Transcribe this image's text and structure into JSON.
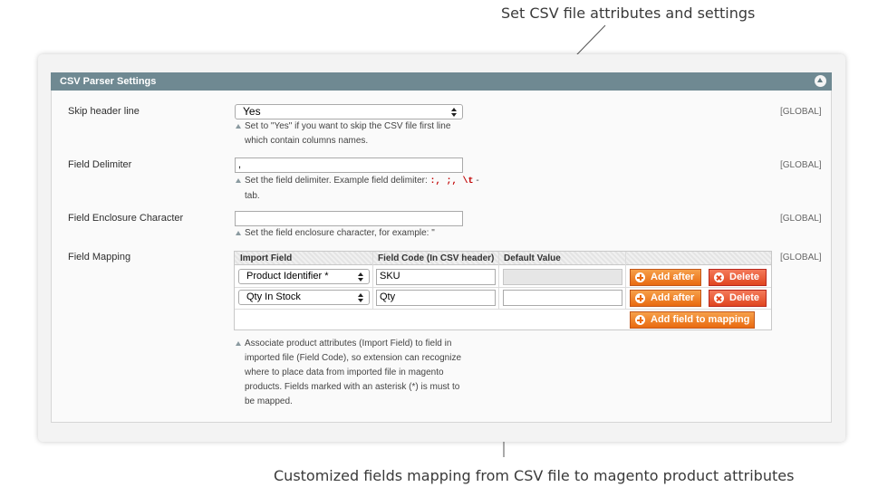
{
  "callouts": {
    "top": "Set CSV file attributes and settings",
    "bottom": "Customized fields mapping from CSV file to magento product attributes"
  },
  "section": {
    "title": "CSV Parser Settings"
  },
  "fields": {
    "skip_header": {
      "label": "Skip header line",
      "value": "Yes",
      "note_line1": "Set to \"Yes\" if you want to skip the CSV file first line",
      "note_line2": "which contain columns names.",
      "scope": "[GLOBAL]"
    },
    "delimiter": {
      "label": "Field Delimiter",
      "value": ",",
      "note_prefix": "Set the field delimiter. Example field delimiter:",
      "note_codes": ":, ;, \\t",
      "note_suffix": "-",
      "note_line2": "tab.",
      "scope": "[GLOBAL]"
    },
    "enclosure": {
      "label": "Field Enclosure Character",
      "value": "",
      "note": "Set the field enclosure character, for example: \"",
      "scope": "[GLOBAL]"
    },
    "mapping": {
      "label": "Field Mapping",
      "scope": "[GLOBAL]",
      "headers": [
        "Import Field",
        "Field Code (In CSV header)",
        "Default Value"
      ],
      "rows": [
        {
          "import_field": "Product Identifier *",
          "field_code": "SKU",
          "default_value": ""
        },
        {
          "import_field": "Qty In Stock",
          "field_code": "Qty",
          "default_value": ""
        }
      ],
      "add_after_label": "Add after",
      "delete_label": "Delete",
      "add_field_label": "Add field to mapping",
      "note_lines": [
        "Associate product attributes (Import Field) to field in",
        "imported file (Field Code), so extension can recognize",
        "where to place data from imported file in magento",
        "products. Fields marked with an asterisk (*) is must to",
        "be mapped."
      ]
    }
  },
  "colors": {
    "header": "#6f8992",
    "button_orange": "#e96a10",
    "button_red": "#e0451f"
  },
  "icons": [
    "collapse-icon",
    "info-icon",
    "plus-icon",
    "delete-icon",
    "select-arrows-icon"
  ]
}
